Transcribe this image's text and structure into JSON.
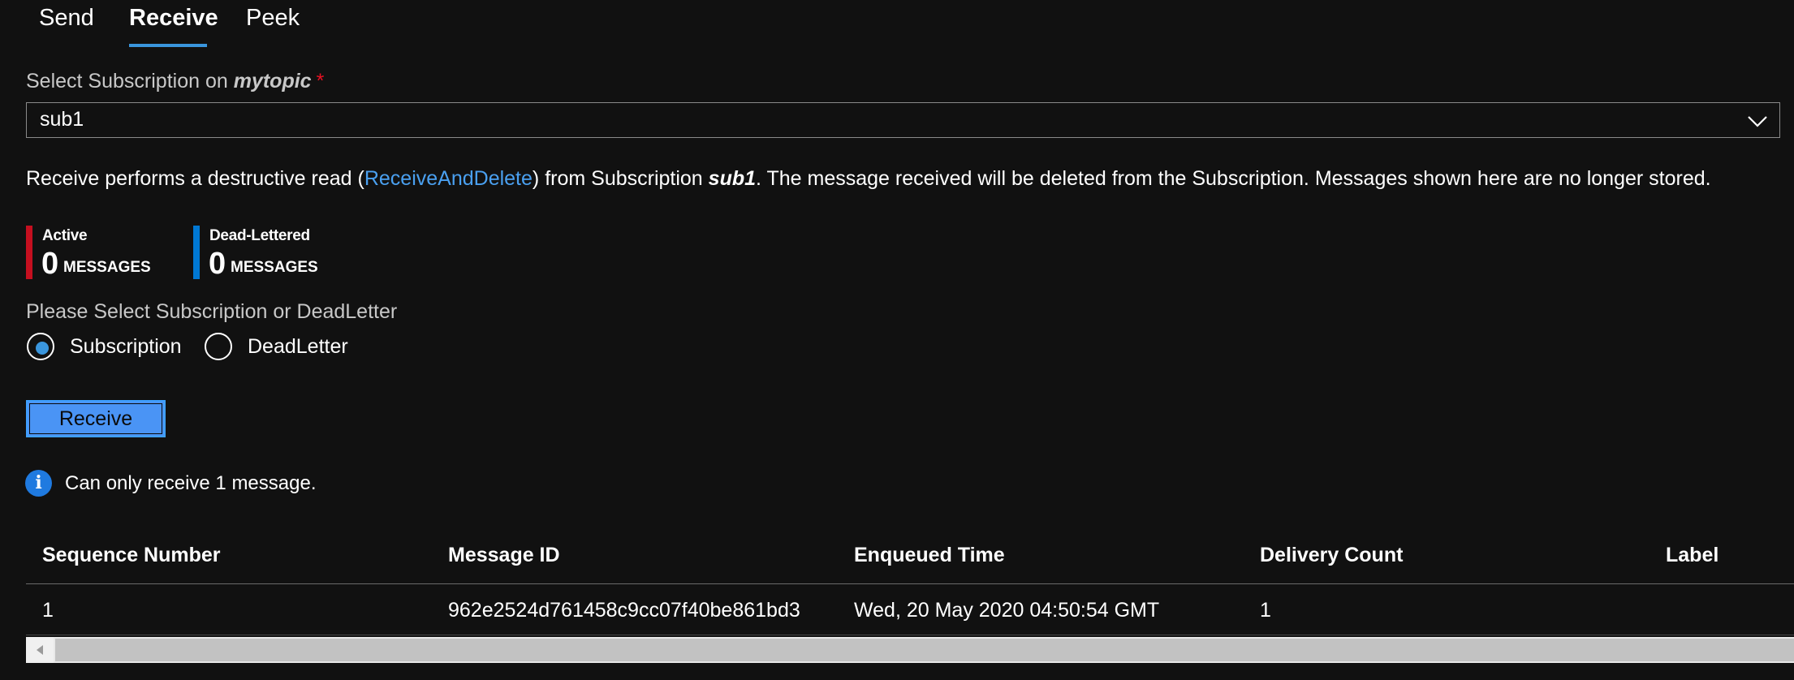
{
  "tabs": [
    {
      "label": "Send"
    },
    {
      "label": "Receive"
    },
    {
      "label": "Peek"
    }
  ],
  "subscription_select": {
    "label_prefix": "Select Subscription on",
    "topic": "mytopic",
    "required_mark": "*",
    "value": "sub1"
  },
  "description": {
    "prefix": "Receive performs a destructive read (",
    "link": "ReceiveAndDelete",
    "middle": ") from Subscription ",
    "subscription": "sub1",
    "suffix": ". The message received will be deleted from the Subscription. Messages shown here are no longer stored."
  },
  "counters": [
    {
      "title": "Active",
      "count": "0",
      "unit": "MESSAGES",
      "color": "#c50f1f"
    },
    {
      "title": "Dead-Lettered",
      "count": "0",
      "unit": "MESSAGES",
      "color": "#0078d4"
    }
  ],
  "source_group": {
    "label": "Please Select Subscription or DeadLetter",
    "options": [
      {
        "label": "Subscription",
        "selected": true
      },
      {
        "label": "DeadLetter",
        "selected": false
      }
    ]
  },
  "receive_button": {
    "label": "Receive"
  },
  "info": {
    "icon": "info-icon",
    "symbol": "i",
    "text": "Can only receive 1 message."
  },
  "table": {
    "columns": [
      "Sequence Number",
      "Message ID",
      "Enqueued Time",
      "Delivery Count",
      "Label"
    ],
    "rows": [
      [
        "1",
        "962e2524d761458c9cc07f40be861bd3",
        "Wed, 20 May 2020 04:50:54 GMT",
        "1",
        ""
      ]
    ]
  },
  "colors": {
    "background": "#111111",
    "accent": "#3a96dd",
    "link": "#4aa0f0",
    "button": "#4a94f5",
    "required": "#e81123"
  }
}
